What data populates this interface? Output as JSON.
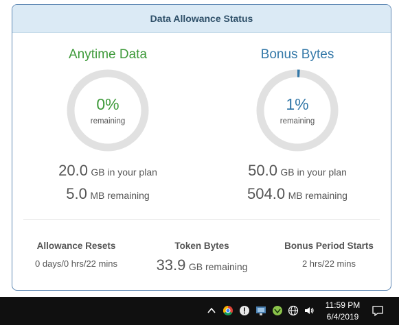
{
  "header": {
    "title": "Data Allowance Status"
  },
  "anytime": {
    "title": "Anytime Data",
    "percent_label": "0%",
    "remaining_label": "remaining",
    "percent_value": 0,
    "plan_value": "20.0",
    "plan_unit": "GB in your plan",
    "left_value": "5.0",
    "left_unit": "MB remaining",
    "color": "#3e9a3a"
  },
  "bonus": {
    "title": "Bonus Bytes",
    "percent_label": "1%",
    "remaining_label": "remaining",
    "percent_value": 1,
    "plan_value": "50.0",
    "plan_unit": "GB in your plan",
    "left_value": "504.0",
    "left_unit": "MB remaining",
    "color": "#3478a8"
  },
  "footer": {
    "resets_title": "Allowance Resets",
    "resets_value": "0 days/0 hrs/22 mins",
    "token_title": "Token Bytes",
    "token_value": "33.9",
    "token_unit": "GB remaining",
    "period_title": "Bonus Period Starts",
    "period_value": "2 hrs/22 mins"
  },
  "taskbar": {
    "time": "11:59 PM",
    "date": "6/4/2019",
    "icons": [
      "chevron-up-icon",
      "chrome-icon",
      "security-icon",
      "network-monitor-icon",
      "vpn-icon",
      "globe-icon",
      "volume-icon",
      "notification-icon"
    ]
  }
}
